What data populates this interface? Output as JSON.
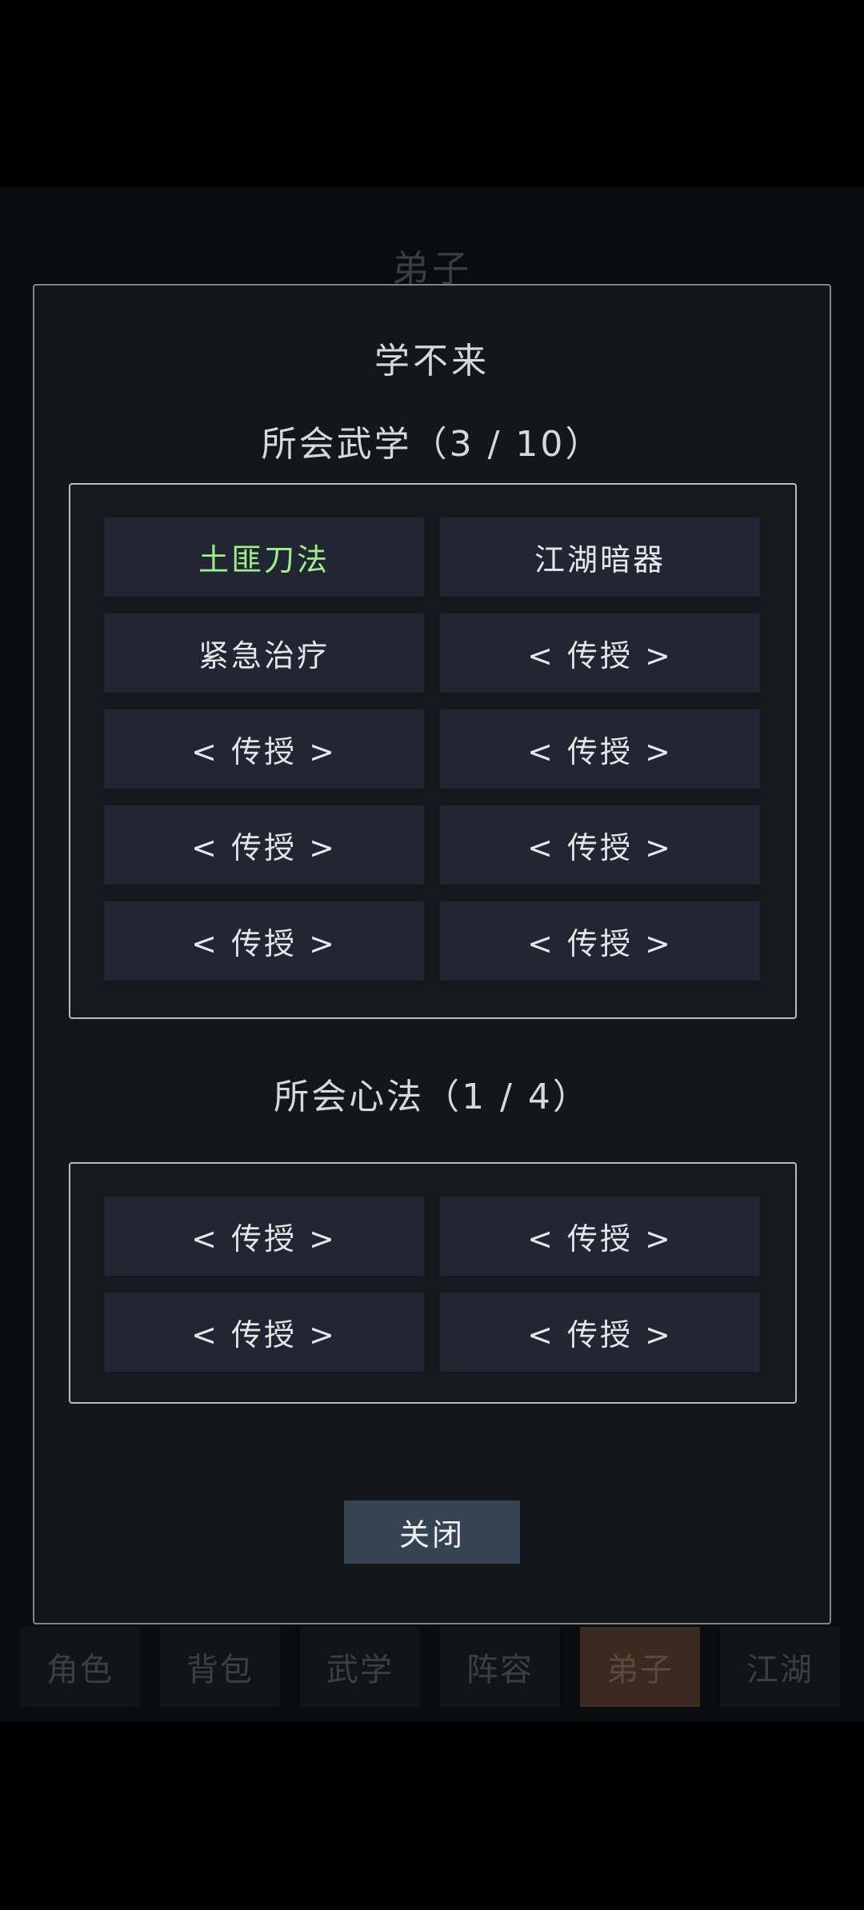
{
  "background": {
    "title": "弟子",
    "nav": [
      "角色",
      "背包",
      "武学",
      "阵容",
      "弟子",
      "江湖"
    ],
    "active_nav": "弟子"
  },
  "dialog": {
    "title": "学不来",
    "martial": {
      "title": "所会武学（3 / 10）",
      "slots": [
        "土匪刀法",
        "江湖暗器",
        "紧急治疗",
        "< 传授 >",
        "< 传授 >",
        "< 传授 >",
        "< 传授 >",
        "< 传授 >",
        "< 传授 >",
        "< 传授 >"
      ],
      "highlight_color": "#9ef08a"
    },
    "mind": {
      "title": "所会心法（1 / 4）",
      "slots": [
        "< 传授 >",
        "< 传授 >",
        "< 传授 >",
        "< 传授 >"
      ]
    },
    "close_label": "关闭"
  }
}
